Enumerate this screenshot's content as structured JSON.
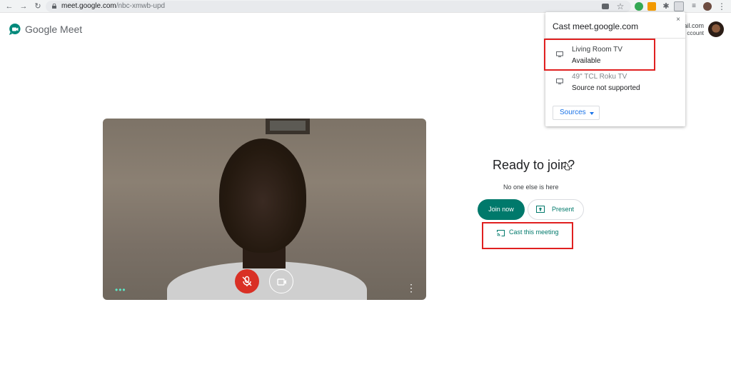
{
  "browser": {
    "url_host": "meet.google.com",
    "url_path": "/nbc-xmwb-upd"
  },
  "header": {
    "app_name": "Google Meet",
    "account_email_fragment": "ail.com",
    "account_sub_fragment": "ccount"
  },
  "ready": {
    "title": "Ready to join?",
    "status": "No one else is here",
    "join_label": "Join now",
    "present_label": "Present",
    "cast_label": "Cast this meeting"
  },
  "cast_dialog": {
    "title": "Cast meet.google.com",
    "close_glyph": "×",
    "sinks": [
      {
        "name": "Living Room TV",
        "status": "Available"
      },
      {
        "name": "49\" TCL Roku TV",
        "status": "Source not supported"
      }
    ],
    "sources_label": "Sources"
  },
  "colors": {
    "accent": "#00796b",
    "mic_off": "#d93025",
    "highlight": "#e02020",
    "link_blue": "#1a73e8"
  }
}
